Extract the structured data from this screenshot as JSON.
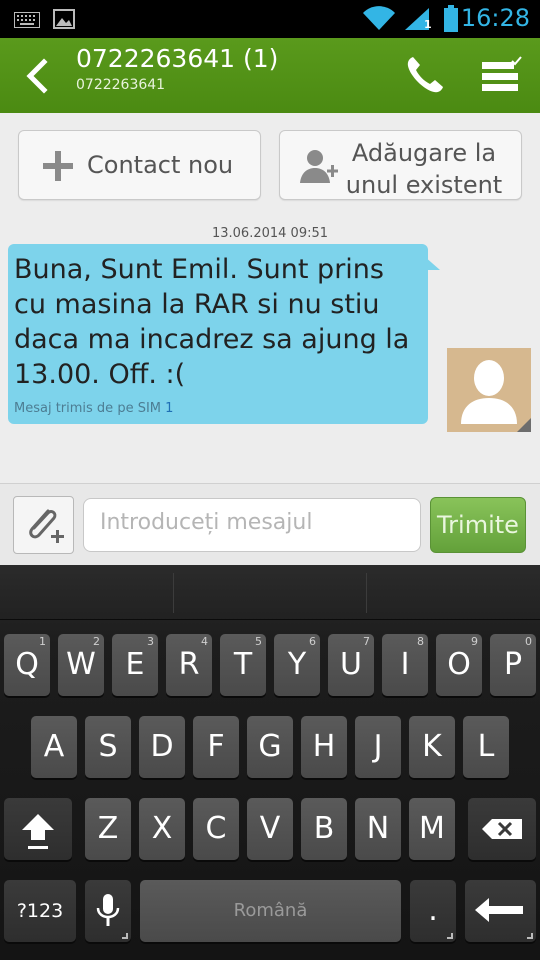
{
  "status_bar": {
    "time": "16:28",
    "icons": [
      "keyboard-icon",
      "image-icon",
      "wifi-icon",
      "signal-icon",
      "battery-icon"
    ],
    "signal_sim_label": "1",
    "accent_color": "#33b5e5"
  },
  "action_bar": {
    "title": "0722263641 (1)",
    "subtitle": "0722263641",
    "background_color": "#5a9a1c"
  },
  "contact_buttons": {
    "new_contact_label": "Contact nou",
    "add_existing_line1": "Adăugare la",
    "add_existing_line2": "unul existent"
  },
  "conversation": {
    "date": "13.06.2014 09:51",
    "message": "Buna, Sunt Emil. Sunt prins cu masina la RAR si nu stiu daca ma incadrez sa ajung la 13.00. Off. :(",
    "sim_label": "Mesaj trimis de pe SIM",
    "sim_number": "1",
    "bubble_color": "#7dd3eb"
  },
  "compose": {
    "placeholder": "Introduceți mesajul",
    "send_label": "Trimite"
  },
  "keyboard": {
    "row1": [
      {
        "char": "Q",
        "num": "1"
      },
      {
        "char": "W",
        "num": "2"
      },
      {
        "char": "E",
        "num": "3"
      },
      {
        "char": "R",
        "num": "4"
      },
      {
        "char": "T",
        "num": "5"
      },
      {
        "char": "Y",
        "num": "6"
      },
      {
        "char": "U",
        "num": "7"
      },
      {
        "char": "I",
        "num": "8"
      },
      {
        "char": "O",
        "num": "9"
      },
      {
        "char": "P",
        "num": "0"
      }
    ],
    "row2": [
      "A",
      "S",
      "D",
      "F",
      "G",
      "H",
      "J",
      "K",
      "L"
    ],
    "row3": [
      "Z",
      "X",
      "C",
      "V",
      "B",
      "N",
      "M"
    ],
    "symbols_label": "?123",
    "space_label": "Română",
    "period_label": "."
  }
}
